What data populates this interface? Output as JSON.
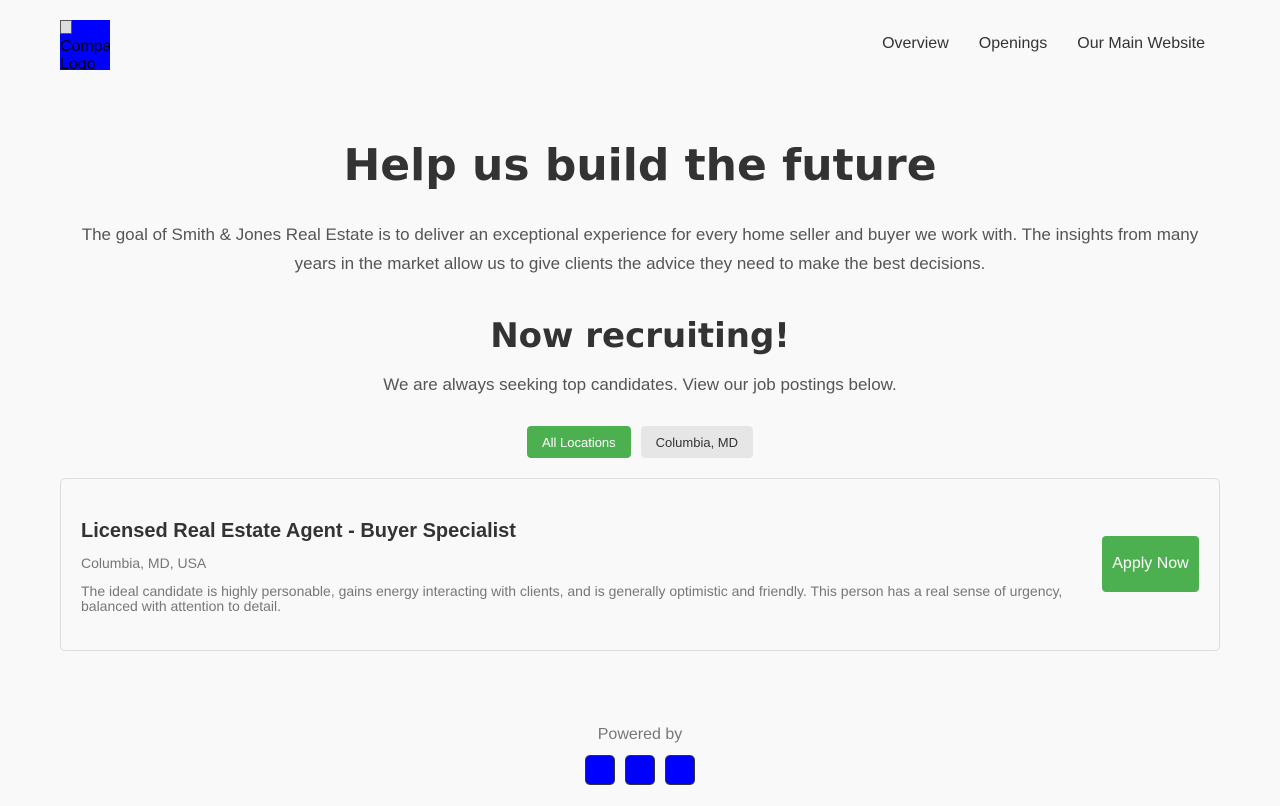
{
  "header": {
    "logo_alt": "Company Logo",
    "nav": [
      "Overview",
      "Openings",
      "Our Main Website"
    ]
  },
  "hero": {
    "title": "Help us build the future",
    "text": "The goal of Smith & Jones Real Estate is to deliver an exceptional experience for every home seller and buyer we work with. The insights from many years in the market allow us to give clients the advice they need to make the best decisions."
  },
  "recruiting": {
    "title": "Now recruiting!",
    "text": "We are always seeking top candidates. View our job postings below.",
    "filters": [
      {
        "label": "All Locations",
        "active": true
      },
      {
        "label": "Columbia, MD",
        "active": false
      }
    ]
  },
  "jobs": [
    {
      "title": "Licensed Real Estate Agent - Buyer Specialist",
      "location": "Columbia, MD, USA",
      "description": "The ideal candidate is highly personable, gains energy interacting with clients, and is generally optimistic and friendly. This person has a real sense of urgency, balanced with attention to detail.",
      "apply_label": "Apply Now"
    }
  ],
  "footer": {
    "powered_by": "Powered by",
    "icons": [
      "partner-logo-1",
      "partner-logo-2",
      "partner-logo-3"
    ]
  },
  "colors": {
    "accent": "#4caf50",
    "placeholder_image": "#0000ff"
  }
}
